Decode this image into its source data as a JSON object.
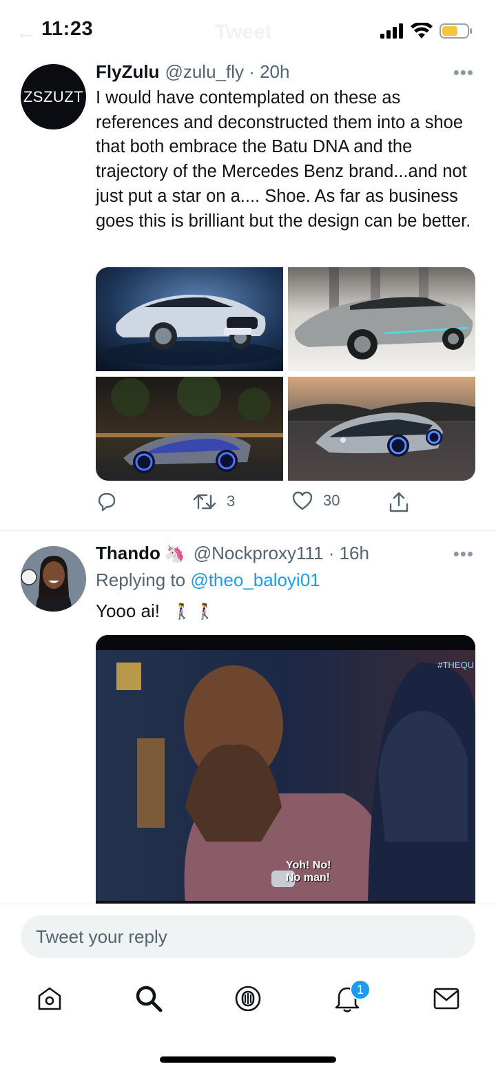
{
  "status_bar": {
    "time": "11:23",
    "ghost_title": "Tweet"
  },
  "tweets": [
    {
      "avatar_text": "ZSZUZT",
      "name": "FlyZulu",
      "handle_time": "@zulu_fly · 20h",
      "text": "I would have contemplated on these as references and deconstructed them into a shoe that both embrace the Batu DNA and the trajectory of the Mercedes Benz brand...and not just put a star on a.... Shoe. As far as business goes this is brilliant but the design can be better.",
      "images": [
        "mercedes-eqs-dark-studio",
        "mercedes-vision-silver-concept",
        "mercedes-vision-avtr-night",
        "mercedes-vision-avtr-road"
      ],
      "actions": {
        "reply_count": "",
        "retweet_count": "3",
        "like_count": "30"
      }
    },
    {
      "name": "Thando",
      "name_emoji": "🦄",
      "handle_time": "@Nockproxy111 · 16h",
      "replying_label": "Replying to",
      "replying_mention": "@theo_baloyi01",
      "text": "Yooo ai!",
      "text_emoji": "🚶‍♀️ 🚶‍♀️",
      "video_subtitle": "Yoh! No!\nNo man!",
      "video_hashtag": "#THEQU"
    }
  ],
  "reply_box": {
    "placeholder": "Tweet your reply"
  },
  "tab_bar": {
    "notifications_badge": "1"
  },
  "colors": {
    "accent": "#1d9bf0",
    "text": "#0f1419",
    "muted": "#536471"
  }
}
